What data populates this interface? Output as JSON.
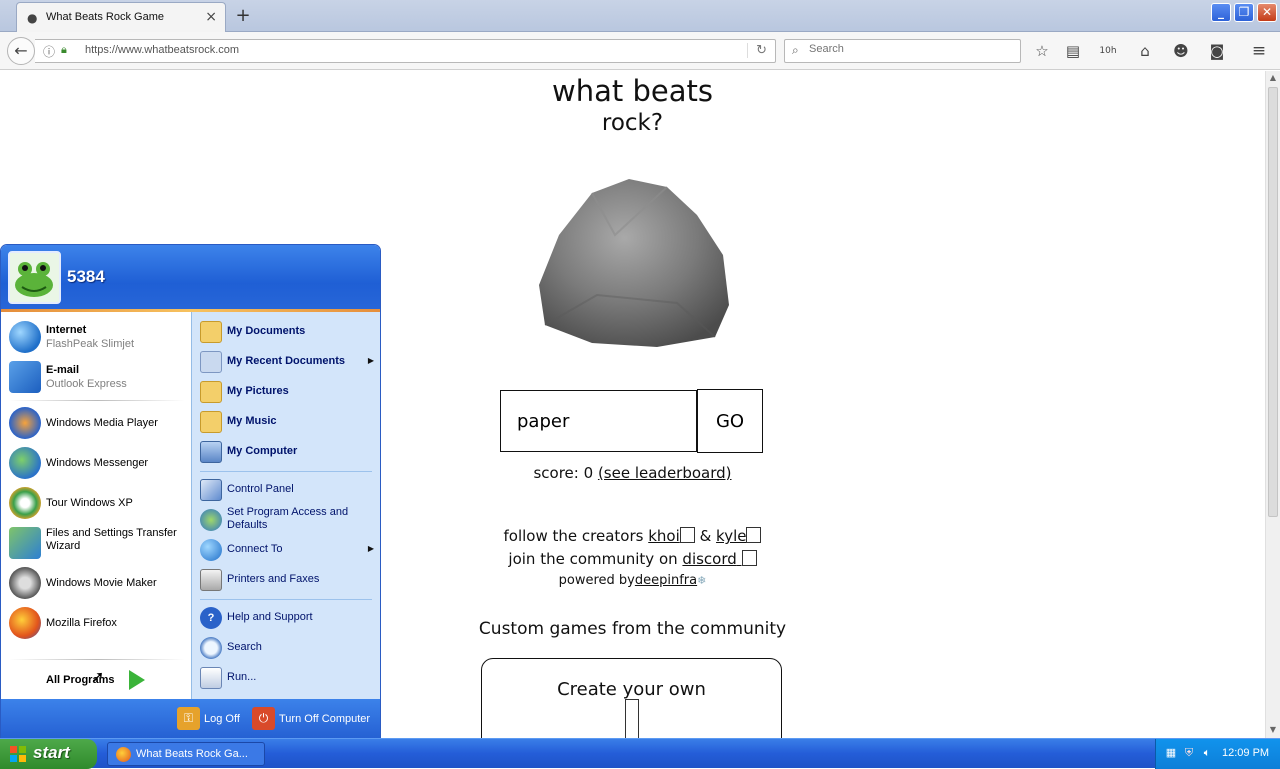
{
  "browser": {
    "tab_title": "What Beats Rock Game",
    "url": "https://www.whatbeatsrock.com",
    "search_placeholder": "Search",
    "toolbar_counter": "10h"
  },
  "page": {
    "heading_line1": "what beats",
    "heading_line2": "rock?",
    "answer_value": "paper",
    "go_label": "GO",
    "score_prefix": "score: 0",
    "leaderboard_link": "(see leaderboard)",
    "follow_prefix": "follow the creators",
    "creator1": "khoi",
    "amp": "&",
    "creator2": "kyle",
    "join_prefix": "join the community on",
    "discord": "discord",
    "powered_prefix": "powered by",
    "deepinfra": "deepinfra",
    "custom_heading": "Custom games from the community",
    "create_own": "Create your own"
  },
  "start_menu": {
    "user_name": "5384",
    "pinned": [
      {
        "title": "Internet",
        "subtitle": "FlashPeak Slimjet"
      },
      {
        "title": "E-mail",
        "subtitle": "Outlook Express"
      }
    ],
    "recent": [
      {
        "label": "Windows Media Player"
      },
      {
        "label": "Windows Messenger"
      },
      {
        "label": "Tour Windows XP"
      },
      {
        "label": "Files and Settings Transfer Wizard"
      },
      {
        "label": "Windows Movie Maker"
      },
      {
        "label": "Mozilla Firefox"
      }
    ],
    "all_programs": "All Programs",
    "places": [
      {
        "label": "My Documents"
      },
      {
        "label": "My Recent Documents"
      },
      {
        "label": "My Pictures"
      },
      {
        "label": "My Music"
      },
      {
        "label": "My Computer"
      }
    ],
    "system": [
      {
        "label": "Control Panel"
      },
      {
        "label": "Set Program Access and Defaults"
      },
      {
        "label": "Connect To"
      },
      {
        "label": "Printers and Faxes"
      }
    ],
    "help": [
      {
        "label": "Help and Support"
      },
      {
        "label": "Search"
      },
      {
        "label": "Run..."
      }
    ],
    "log_off": "Log Off",
    "turn_off": "Turn Off Computer"
  },
  "taskbar": {
    "start_label": "start",
    "task_label": "What Beats Rock Ga...",
    "clock": "12:09 PM"
  },
  "colors": {
    "xp_blue": "#245dd8",
    "start_green": "#3bb43a",
    "menu_right_bg": "#d3e5fa"
  }
}
